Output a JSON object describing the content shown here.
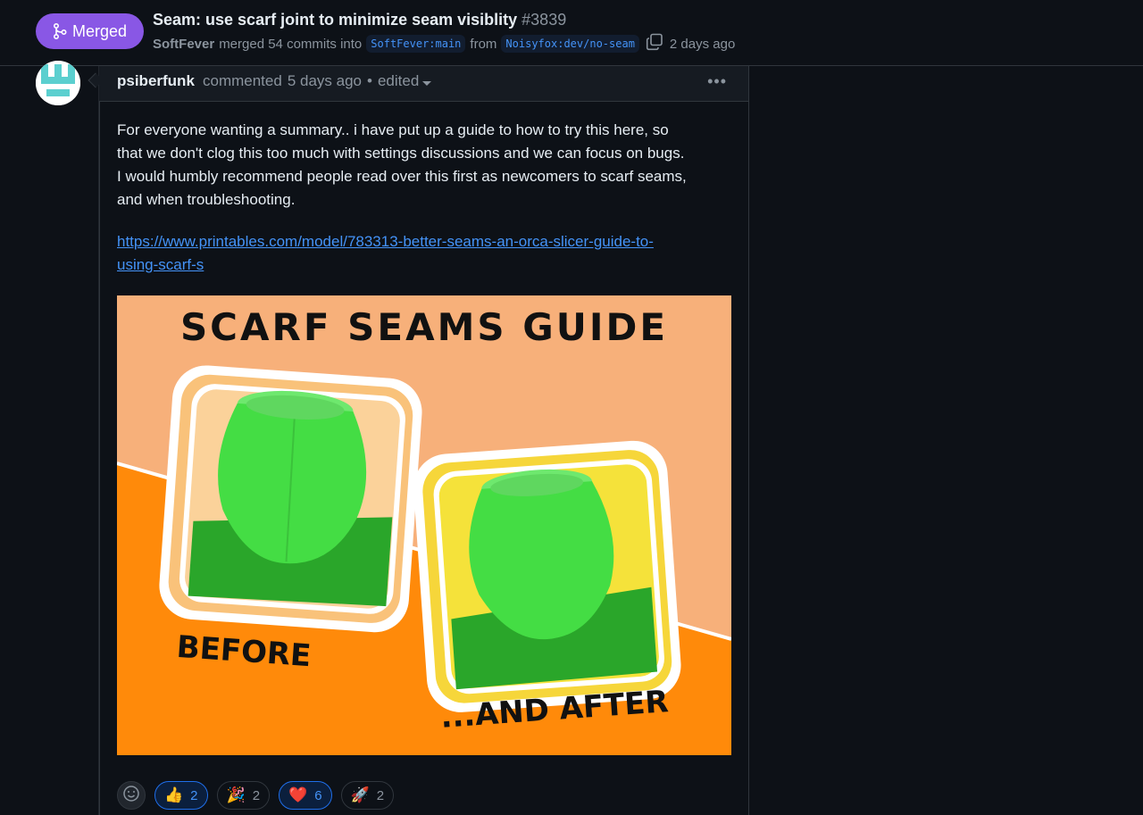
{
  "pr": {
    "status": "Merged",
    "title": "Seam: use scarf joint to minimize seam visiblity",
    "number": "#3839",
    "merger": "SoftFever",
    "merged_text": "merged 54 commits into",
    "base_branch": "SoftFever:main",
    "from_text": "from",
    "head_branch": "Noisyfox:dev/no-seam",
    "time": "2 days ago"
  },
  "comment": {
    "author": "psiberfunk",
    "action": "commented",
    "time": "5 days ago",
    "separator": "•",
    "edited": "edited",
    "menu": "•••",
    "body_lines": [
      "For everyone wanting a summary.. i have put up a guide to how to try this here, so",
      "that we don't clog this too much with settings discussions and we can focus on bugs.",
      "I would humbly recommend people read over this first as newcomers to scarf seams,",
      "and when troubleshooting."
    ],
    "link_line1": "https://www.printables.com/model/783313-better-seams-an-orca-slicer-guide-to-",
    "link_line2": "using-scarf-s",
    "image": {
      "heading": "SCARF SEAMS GUIDE",
      "before": "BEFORE",
      "after": "...AND AFTER"
    }
  },
  "reactions": [
    {
      "emoji": "👍",
      "count": "2",
      "active": true
    },
    {
      "emoji": "🎉",
      "count": "2",
      "active": false
    },
    {
      "emoji": "❤️",
      "count": "6",
      "active": true
    },
    {
      "emoji": "🚀",
      "count": "2",
      "active": false
    }
  ],
  "colors": {
    "merged": "#8957e5",
    "link": "#4493f8",
    "background": "#0d1117"
  }
}
